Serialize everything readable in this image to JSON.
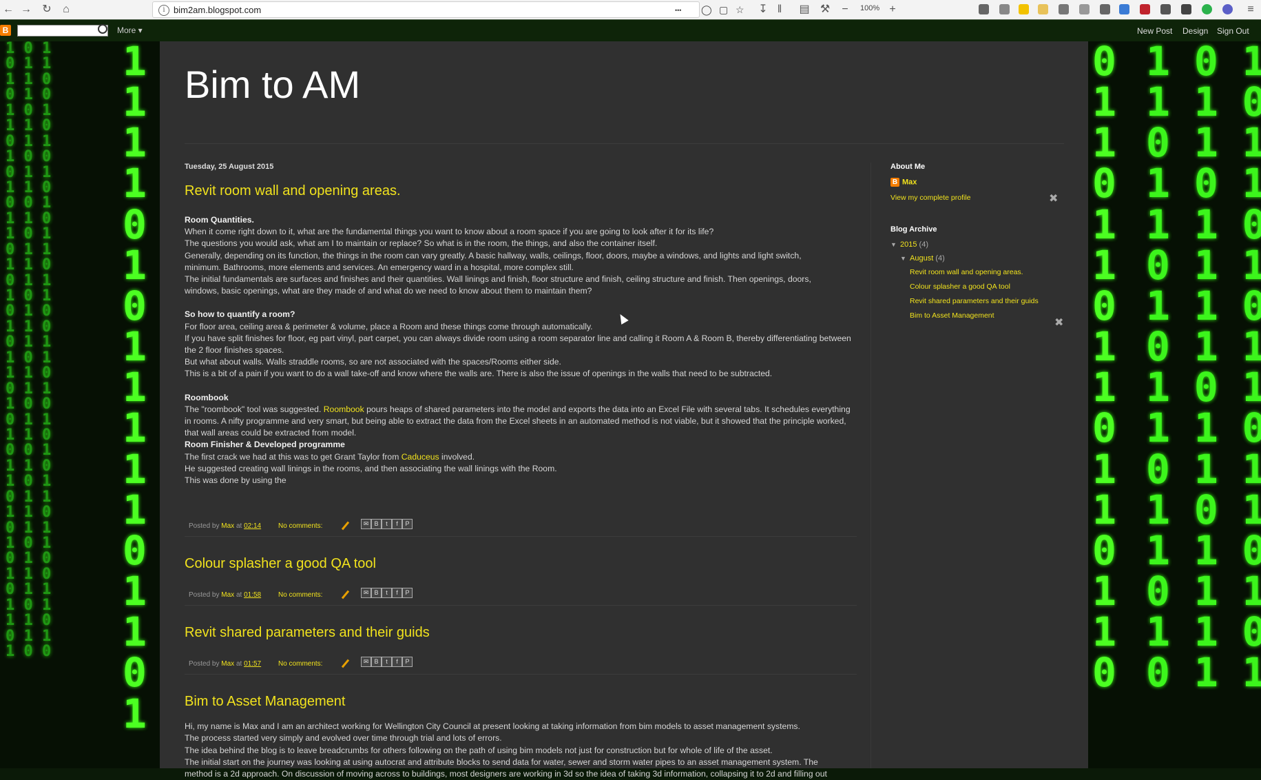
{
  "browser": {
    "url": "bim2am.blogspot.com",
    "zoom": "100%",
    "menu_dots": "•••"
  },
  "navbar": {
    "more_label": "More ▾",
    "new_post": "New Post",
    "design": "Design",
    "sign_out": "Sign Out"
  },
  "blog": {
    "title": "Bim to AM"
  },
  "posts": [
    {
      "date": "Tuesday, 25 August 2015",
      "title": "Revit room wall and opening areas.",
      "s1_heading": "Room Quantities.",
      "s1_lines": [
        " When it come right down to it,  what are the fundamental things you want to know about a room  space if you are going to look after it for its life?",
        "The questions you would ask,  what am I to maintain  or replace?  So what is in the room,  the things,  and also the container itself.",
        "Generally,  depending on its function,  the things in the room can vary greatly. A basic hallway,  walls,  ceilings,  floor, doors,  maybe a windows,  and lights and light switch,",
        " minimum. Bathrooms,  more elements and services. An emergency ward in a hospital,  more complex still.",
        " The initial fundamentals are surfaces and finishes and their quantities.  Wall linings and finish,  floor structure and finish,  ceiling structure and finish.  Then openings,  doors,",
        " windows,  basic openings,  what are they made of and what do we need to know about them to maintain them?"
      ],
      "s2_heading": "So how to quantify a room?",
      "s2_lines": [
        "For floor area, ceiling area & perimeter & volume, place a Room and these things come through automatically.",
        "If you have split finishes for floor, eg part vinyl, part carpet, you can always divide room using a room separator line and calling it Room A & Room B, thereby differentiating between",
        "the 2 floor finishes spaces.",
        "But what about walls. Walls straddle rooms, so are not associated with the spaces/Rooms either side.",
        "This is a bit of a pain if you want to do a wall take-off and know where the walls are. There is also the issue of openings in the walls that need to be subtracted."
      ],
      "s3_heading": "Roombook",
      "s3_pre": "The \"roombook\"  tool was suggested. ",
      "s3_link": "Roombook",
      "s3_post": " pours heaps of shared parameters into the model and exports the data into an Excel File with several tabs. It schedules everything",
      "s3_lines": [
        "in rooms. A nifty programme and very smart, but being able to extract the data from the Excel sheets in an automated method is not viable, but it showed that the principle worked,",
        "that wall areas could be extracted from model."
      ],
      "s4_heading": "Room Finisher & Developed programme",
      "s4_pre": "The first crack we had at this was to get  Grant Taylor from ",
      "s4_link": "Caduceus",
      "s4_post": " involved.",
      "s4_lines": [
        "He suggested creating wall linings in the rooms, and then associating the wall linings with the Room.",
        "This was done by using the"
      ],
      "footer": {
        "posted_by": "Posted by ",
        "author": "Max",
        "at": " at ",
        "time": "02:14",
        "comments": "No comments:"
      }
    },
    {
      "title": "Colour splasher a good QA tool",
      "footer": {
        "posted_by": "Posted by ",
        "author": "Max",
        "at": " at ",
        "time": "01:58",
        "comments": "No comments:"
      }
    },
    {
      "title": "Revit shared parameters and their guids",
      "footer": {
        "posted_by": "Posted by ",
        "author": "Max",
        "at": " at ",
        "time": "01:57",
        "comments": "No comments:"
      }
    },
    {
      "title": "Bim to Asset Management",
      "lines": [
        "Hi,  my name is Max and I am an architect working for Wellington City Council at present looking at taking information from bim models to asset management systems.",
        " The process started very simply and evolved over time through trial and lots of errors.",
        " The idea behind the blog is to leave breadcrumbs for others following on the path of using bim models not just for construction but for whole of life of the asset.",
        " The initial start on the journey was looking at using autocrat and attribute blocks to send data for water,  sewer and storm water pipes to an asset management system.  The",
        "method is a 2d approach.  On discussion of moving across to buildings,  most designers are working in 3d so the idea of taking 3d information,  collapsing it to 2d and filling out"
      ]
    }
  ],
  "sidebar": {
    "about_title": "About Me",
    "profile_name": "Max",
    "profile_link": "View my complete profile",
    "archive_title": "Blog Archive",
    "year": "2015",
    "year_count": "(4)",
    "month": "August",
    "month_count": "(4)",
    "archive_posts": [
      "Revit room wall and opening areas.",
      "Colour splasher a good QA tool",
      "Revit shared parameters and their guids",
      "Bim to Asset Management"
    ]
  },
  "icons": [
    "back-icon",
    "forward-icon",
    "reload-icon",
    "home-icon",
    "info-icon",
    "pocket-icon",
    "reader-icon",
    "bookmark-star-icon",
    "download-icon",
    "library-icon",
    "sidebar-icon",
    "wrench-icon",
    "zoom-out-icon",
    "zoom-in-icon",
    "blogger-icon",
    "search-icon",
    "pencil-edit-icon",
    "email-share-icon",
    "blogthis-icon",
    "twitter-share-icon",
    "facebook-share-icon",
    "pinterest-share-icon",
    "gadget-settings-icon"
  ],
  "colors": {
    "accent": "#f1e21d",
    "page_bg": "#303030",
    "matrix_green": "#39ff14",
    "blogger_orange": "#f57d00"
  }
}
